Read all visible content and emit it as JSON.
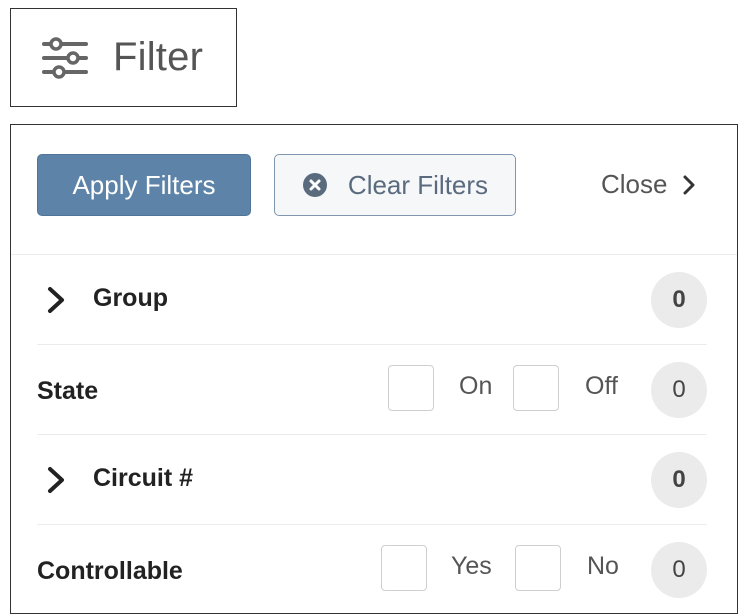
{
  "filter_toggle": {
    "label": "Filter",
    "icon": "sliders-icon"
  },
  "toolbar": {
    "apply_label": "Apply Filters",
    "clear_label": "Clear Filters",
    "close_label": "Close",
    "apply_color": "#5d84a8"
  },
  "rows": {
    "group": {
      "label": "Group",
      "count": "0"
    },
    "state": {
      "label": "State",
      "opt1": "On",
      "opt2": "Off",
      "count": "0"
    },
    "circuit": {
      "label": "Circuit #",
      "count": "0"
    },
    "controllable": {
      "label": "Controllable",
      "opt1": "Yes",
      "opt2": "No",
      "count": "0"
    }
  }
}
